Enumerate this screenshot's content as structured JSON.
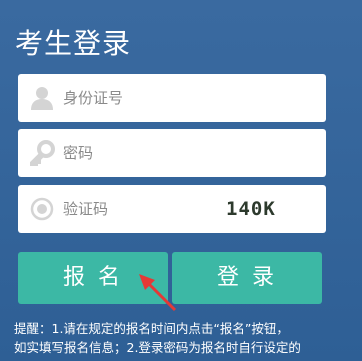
{
  "title": "考生登录",
  "form": {
    "username_placeholder": "身份证号",
    "password_placeholder": "密码",
    "captcha_placeholder": "验证码",
    "captcha_code": "140K",
    "icons": {
      "username": "user-icon",
      "password": "key-icon",
      "captcha": "radio-icon"
    }
  },
  "buttons": {
    "register": "报名",
    "login": "登录"
  },
  "notice": {
    "line1": "提醒：1.请在规定的报名时间内点击“报名”按钮，",
    "line2": "如实填写报名信息；2.登录密码为报名时自行设定的"
  },
  "colors": {
    "background": "#2f5f93",
    "button": "#3cb8a5",
    "arrow": "#e53935"
  }
}
